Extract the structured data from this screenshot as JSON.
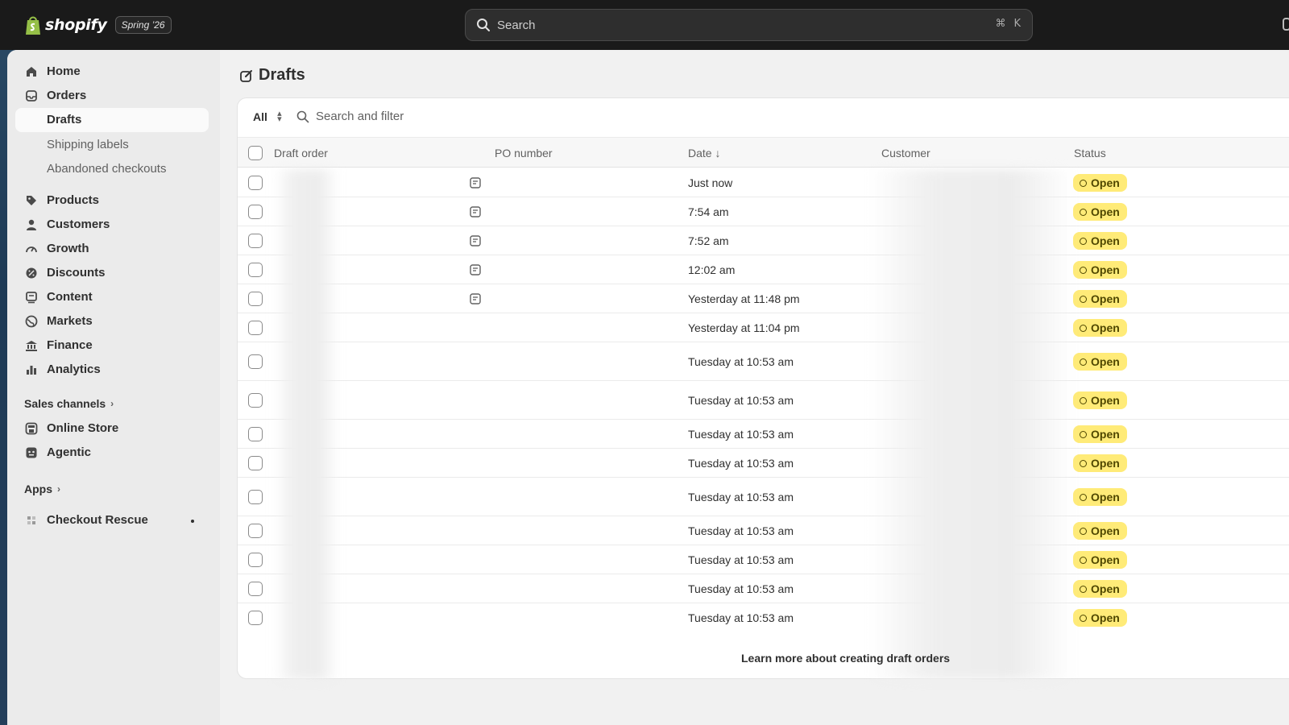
{
  "brand": {
    "name": "shopify",
    "edition": "Spring ’26"
  },
  "search": {
    "placeholder": "Search",
    "shortcut_mod": "⌘",
    "shortcut_key": "K"
  },
  "sidebar": {
    "items": [
      {
        "label": "Home",
        "icon": "home-icon"
      },
      {
        "label": "Orders",
        "icon": "orders-icon"
      },
      {
        "label": "Drafts",
        "icon": "branch-icon"
      },
      {
        "label": "Shipping labels"
      },
      {
        "label": "Abandoned checkouts"
      },
      {
        "label": "Products",
        "icon": "tag-icon"
      },
      {
        "label": "Customers",
        "icon": "person-icon"
      },
      {
        "label": "Growth",
        "icon": "gauge-icon"
      },
      {
        "label": "Discounts",
        "icon": "discount-icon"
      },
      {
        "label": "Content",
        "icon": "content-icon"
      },
      {
        "label": "Markets",
        "icon": "globe-icon"
      },
      {
        "label": "Finance",
        "icon": "bank-icon"
      },
      {
        "label": "Analytics",
        "icon": "bar-chart-icon"
      }
    ],
    "sales_channels": {
      "label": "Sales channels",
      "items": [
        {
          "label": "Online Store",
          "icon": "store-icon"
        },
        {
          "label": "Agentic",
          "icon": "agent-icon"
        }
      ]
    },
    "apps": {
      "label": "Apps",
      "items": [
        {
          "label": "Checkout Rescue",
          "icon": "app-icon"
        }
      ]
    }
  },
  "page": {
    "title": "Drafts"
  },
  "filters": {
    "tab": "All",
    "search_placeholder": "Search and filter"
  },
  "table": {
    "columns": [
      "Draft order",
      "PO number",
      "Date ↓",
      "Customer",
      "Status"
    ],
    "rows": [
      {
        "date": "Just now",
        "status": "Open",
        "note": true
      },
      {
        "date": "7:54 am",
        "status": "Open",
        "note": true
      },
      {
        "date": "7:52 am",
        "status": "Open",
        "note": true
      },
      {
        "date": "12:02 am",
        "status": "Open",
        "note": true
      },
      {
        "date": "Yesterday at 11:48 pm",
        "status": "Open",
        "note": true
      },
      {
        "date": "Yesterday at 11:04 pm",
        "status": "Open",
        "note": false
      },
      {
        "date": "Tuesday at 10:53 am",
        "status": "Open",
        "note": false
      },
      {
        "date": "Tuesday at 10:53 am",
        "status": "Open",
        "note": false
      },
      {
        "date": "Tuesday at 10:53 am",
        "status": "Open",
        "note": false
      },
      {
        "date": "Tuesday at 10:53 am",
        "status": "Open",
        "note": false
      },
      {
        "date": "Tuesday at 10:53 am",
        "status": "Open",
        "note": false
      },
      {
        "date": "Tuesday at 10:53 am",
        "status": "Open",
        "note": false
      },
      {
        "date": "Tuesday at 10:53 am",
        "status": "Open",
        "note": false
      },
      {
        "date": "Tuesday at 10:53 am",
        "status": "Open",
        "note": false
      },
      {
        "date": "Tuesday at 10:53 am",
        "status": "Open",
        "note": false
      }
    ]
  },
  "footer": {
    "learn_more": "Learn more about creating draft orders"
  },
  "colors": {
    "topbar": "#1a1a1a",
    "badge_open": "#ffeb78",
    "badge_text": "#4f4700"
  }
}
